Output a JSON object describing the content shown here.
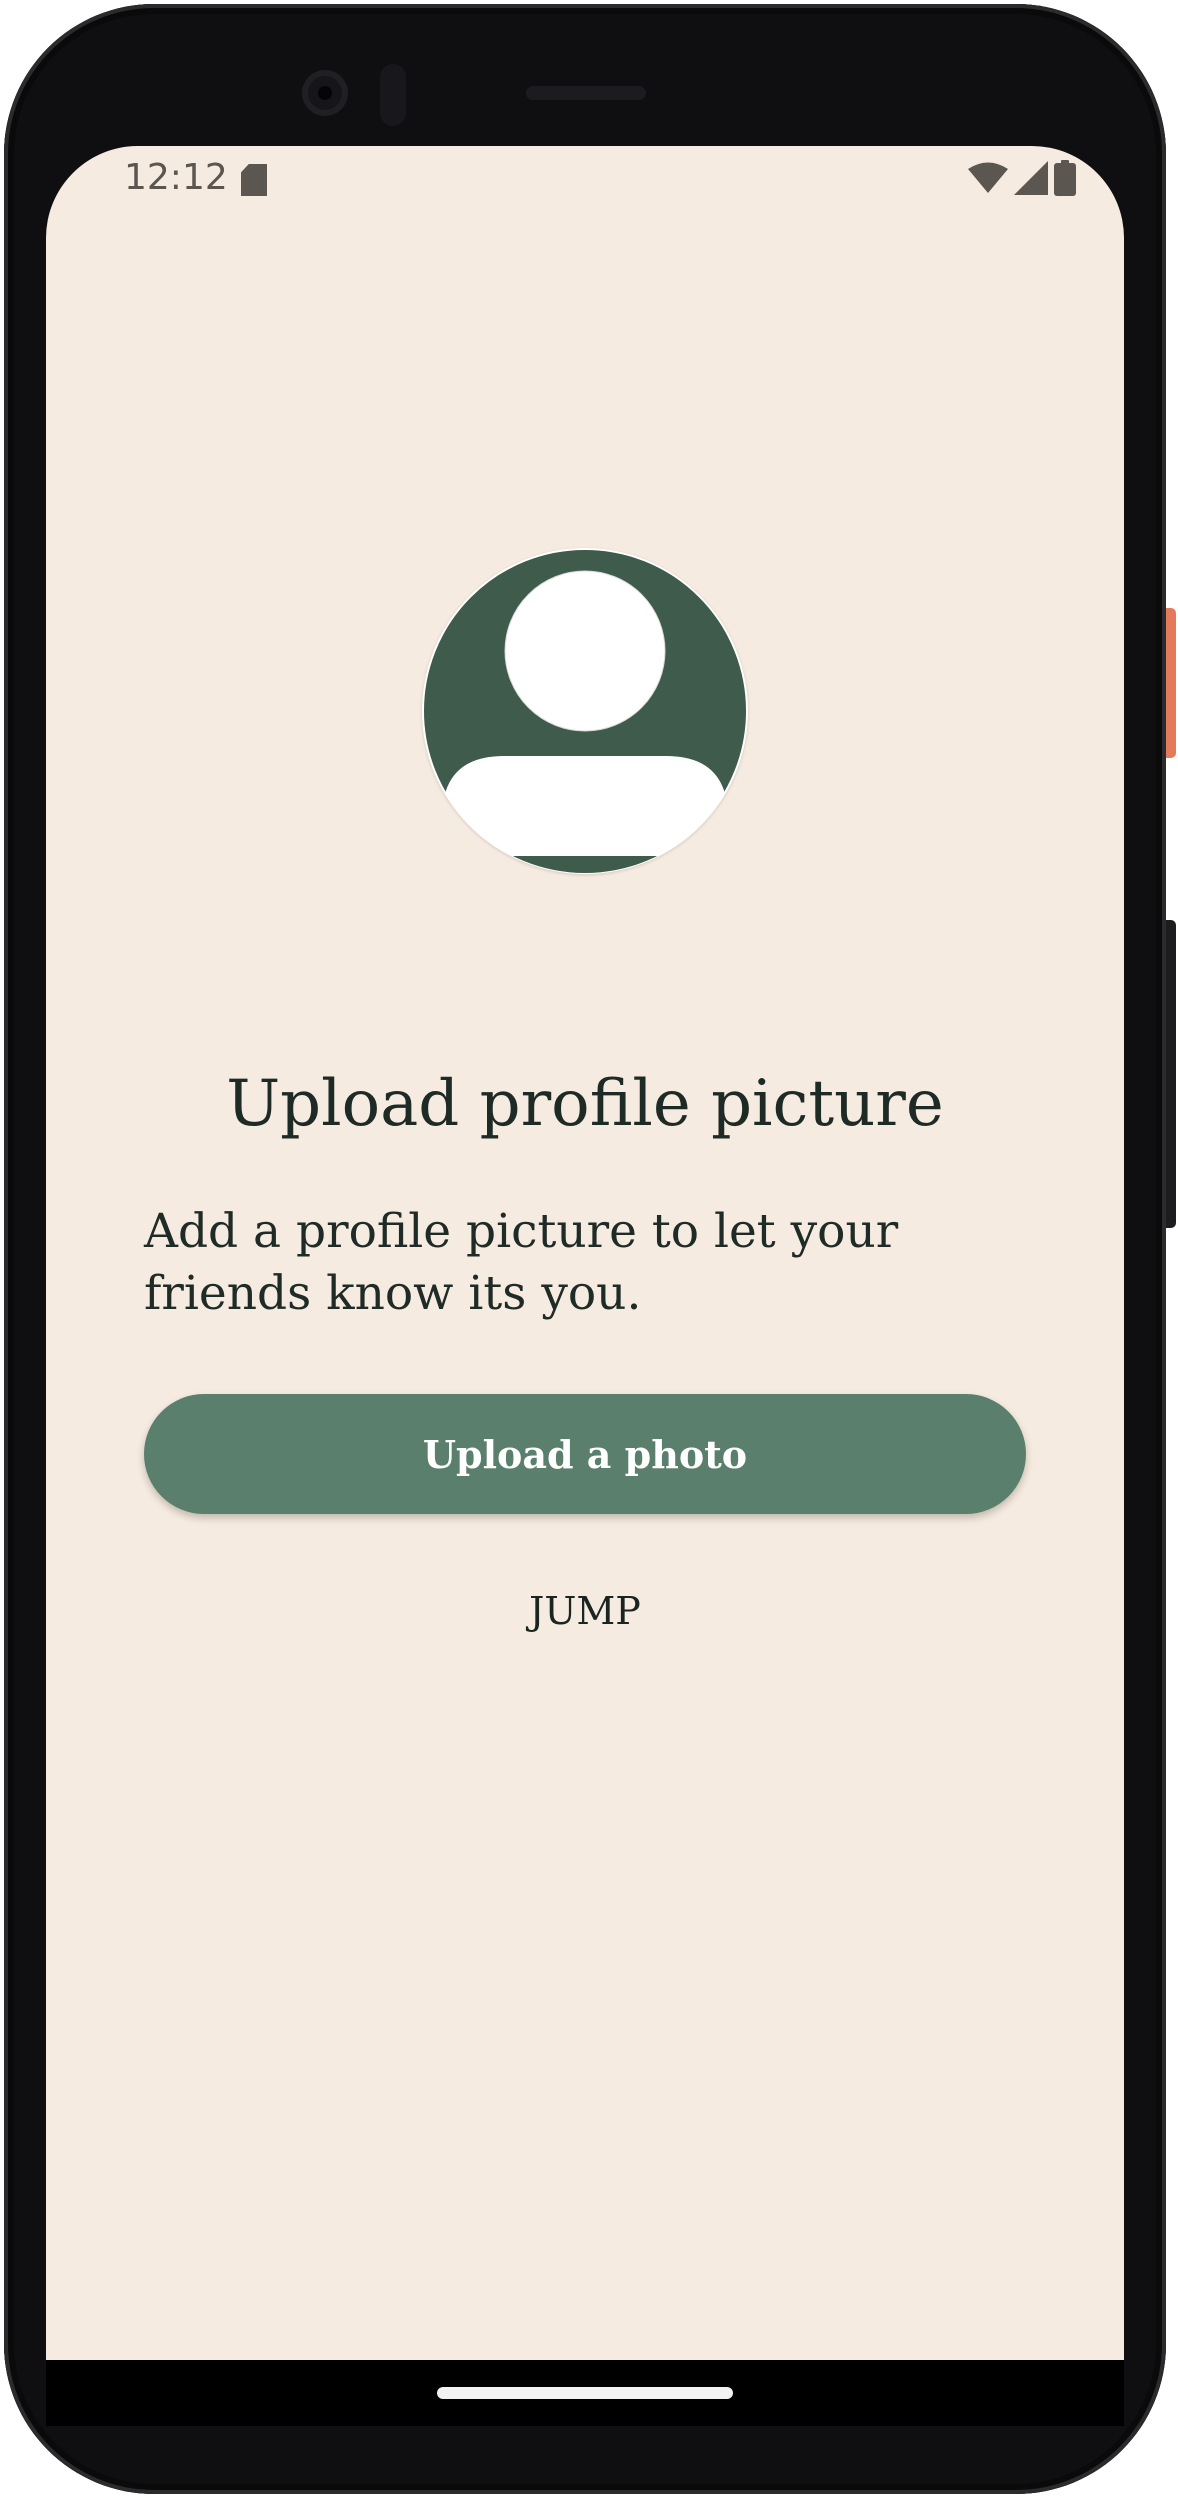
{
  "status_bar": {
    "time": "12:12",
    "icons": [
      "sd-card-icon",
      "wifi-icon",
      "cell-signal-icon",
      "battery-icon"
    ]
  },
  "profile": {
    "avatar_icon": "default-avatar-icon",
    "title": "Upload profile picture",
    "description": "Add a profile picture to let your friends know its you.",
    "upload_button_label": "Upload a photo",
    "skip_button_label": "JUMP"
  },
  "colors": {
    "background": "#f6ebe0",
    "accent": "#5a7f6c",
    "avatar_background": "#3f5b4c",
    "text": "#1e2a25"
  }
}
